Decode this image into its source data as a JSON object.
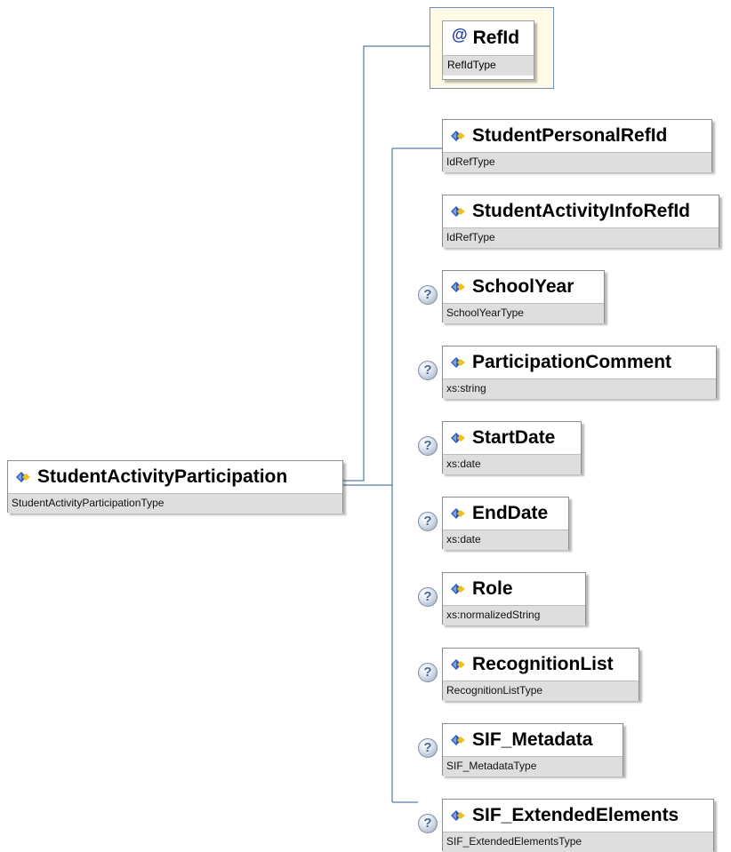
{
  "root": {
    "name": "StudentActivityParticipation",
    "type": "StudentActivityParticipationType"
  },
  "attribute": {
    "name": "RefId",
    "type": "RefIdType",
    "symbol": "@"
  },
  "optional_symbol": "?",
  "elements": [
    {
      "name": "StudentPersonalRefId",
      "type": "IdRefType",
      "optional": false
    },
    {
      "name": "StudentActivityInfoRefId",
      "type": "IdRefType",
      "optional": false
    },
    {
      "name": "SchoolYear",
      "type": "SchoolYearType",
      "optional": true
    },
    {
      "name": "ParticipationComment",
      "type": "xs:string",
      "optional": true
    },
    {
      "name": "StartDate",
      "type": "xs:date",
      "optional": true
    },
    {
      "name": "EndDate",
      "type": "xs:date",
      "optional": true
    },
    {
      "name": "Role",
      "type": "xs:normalizedString",
      "optional": true
    },
    {
      "name": "RecognitionList",
      "type": "RecognitionListType",
      "optional": true
    },
    {
      "name": "SIF_Metadata",
      "type": "SIF_MetadataType",
      "optional": true
    },
    {
      "name": "SIF_ExtendedElements",
      "type": "SIF_ExtendedElementsType",
      "optional": true
    }
  ],
  "colors": {
    "connector": "#2e5d9a",
    "icon_blue": "#2f5fb8",
    "icon_yellow": "#f0c020",
    "type_bar": "#dedede"
  },
  "icons": {
    "element": "element-diamond-icon",
    "attribute": "attribute-at-icon",
    "optional": "optional-question-icon"
  }
}
